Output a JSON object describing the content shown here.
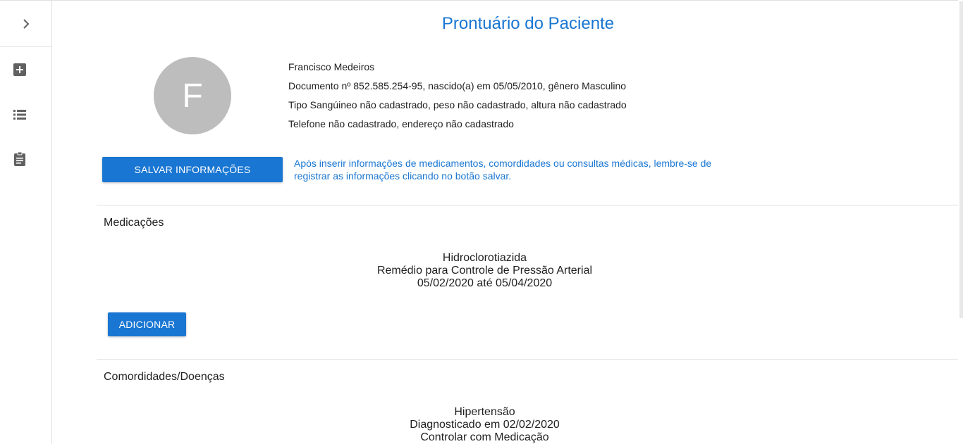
{
  "sidebar": {
    "toggle_icon": "chevron-right-icon",
    "items": [
      {
        "icon": "add-box-icon"
      },
      {
        "icon": "list-icon"
      },
      {
        "icon": "clipboard-icon"
      }
    ]
  },
  "header": {
    "title": "Prontuário do Paciente"
  },
  "patient": {
    "avatar_letter": "F",
    "name": "Francisco Medeiros",
    "document_line": "Documento nº 852.585.254-95, nascido(a) em 05/05/2010, gênero Masculino",
    "blood_line": "Tipo Sangúineo não cadastrado, peso não cadastrado, altura não cadastrado",
    "contact_line": "Telefone não cadastrado, endereço não cadastrado"
  },
  "actions": {
    "save_label": "SALVAR INFORMAÇÕES",
    "reminder_text": "Após inserir informações de medicamentos, comordidades ou consultas médicas, lembre-se de registrar as informações clicando no botão salvar."
  },
  "medications": {
    "title": "Medicações",
    "items": [
      {
        "name": "Hidroclorotiazida",
        "description": "Remédio para Controle de Pressão Arterial",
        "period": "05/02/2020 até 05/04/2020"
      }
    ],
    "add_label": "ADICIONAR"
  },
  "comorbidities": {
    "title": "Comordidades/Doenças",
    "items": [
      {
        "name": "Hipertensão",
        "diagnosed": "Diagnosticado em 02/02/2020",
        "treatment": "Controlar com Medicação"
      }
    ]
  },
  "colors": {
    "primary": "#1976d2",
    "avatar_bg": "#bdbdbd",
    "divider": "#e0e0e0"
  }
}
